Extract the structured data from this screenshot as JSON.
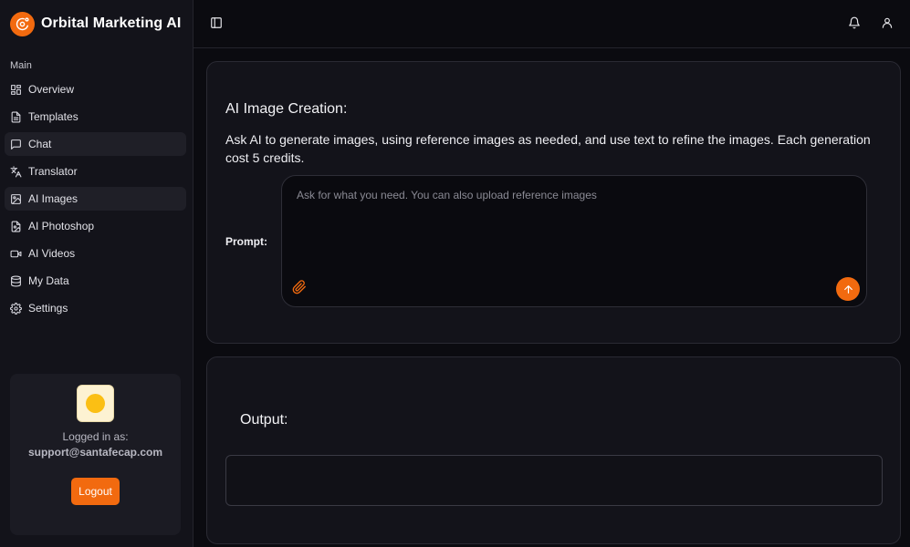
{
  "brand": {
    "name": "Orbital Marketing AI",
    "logo_icon": "orbit-logo-icon",
    "accent_color": "#f26a0f"
  },
  "sidebar": {
    "section_label": "Main",
    "items": [
      {
        "label": "Overview",
        "icon": "grid-icon",
        "active": false
      },
      {
        "label": "Templates",
        "icon": "document-icon",
        "active": false
      },
      {
        "label": "Chat",
        "icon": "chat-icon",
        "active": true
      },
      {
        "label": "Translator",
        "icon": "translate-icon",
        "active": false
      },
      {
        "label": "AI Images",
        "icon": "image-icon",
        "active": true
      },
      {
        "label": "AI Photoshop",
        "icon": "image-file-icon",
        "active": false
      },
      {
        "label": "AI Videos",
        "icon": "video-icon",
        "active": false
      },
      {
        "label": "My Data",
        "icon": "database-icon",
        "active": false
      },
      {
        "label": "Settings",
        "icon": "gear-icon",
        "active": false
      }
    ]
  },
  "user": {
    "logged_label": "Logged in as:",
    "email": "support@santafecap.com",
    "logout_label": "Logout"
  },
  "topbar": {
    "toggle_icon": "sidebar-toggle-icon",
    "notification_icon": "bell-icon",
    "profile_icon": "user-icon"
  },
  "creation": {
    "title": "AI Image Creation:",
    "description": "Ask AI to generate images, using reference images as needed, and use text to refine the images. Each generation cost 5 credits.",
    "prompt_label": "Prompt:",
    "prompt_placeholder": "Ask for what you need. You can also upload reference images",
    "prompt_value": ""
  },
  "output": {
    "title": "Output:",
    "content": ""
  }
}
